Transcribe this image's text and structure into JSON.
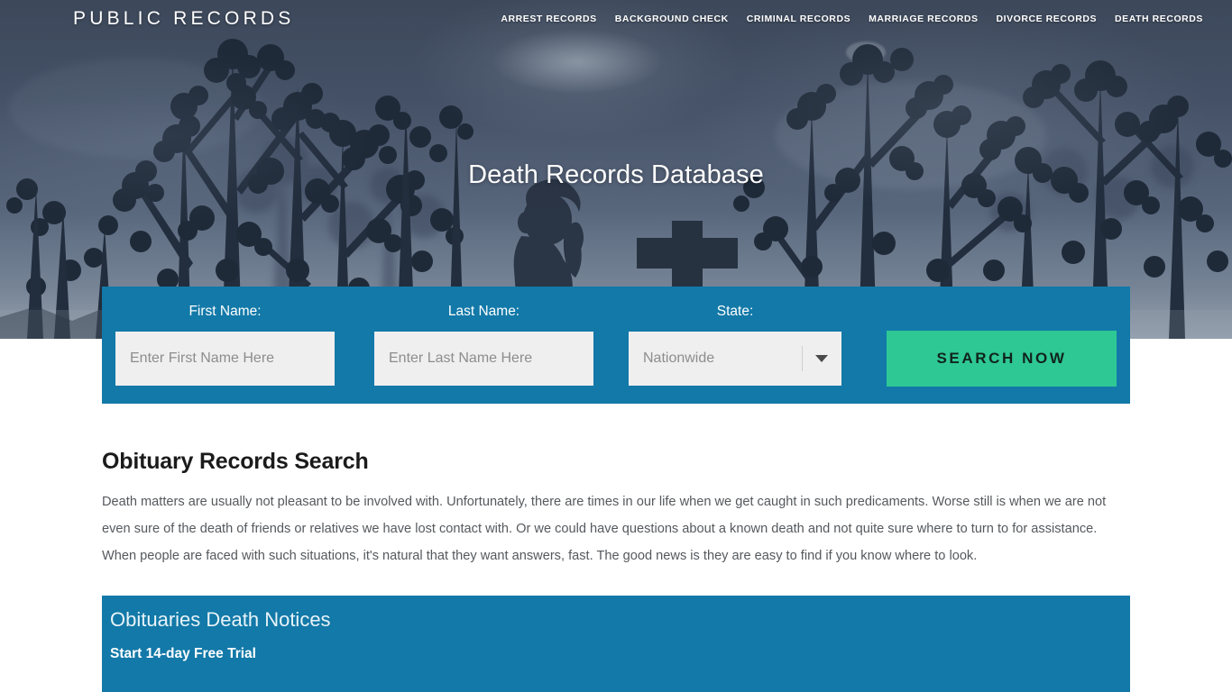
{
  "header": {
    "logo": "PUBLIC RECORDS",
    "nav": [
      {
        "label": "ARREST RECORDS"
      },
      {
        "label": "BACKGROUND CHECK"
      },
      {
        "label": "CRIMINAL RECORDS"
      },
      {
        "label": "MARRIAGE RECORDS"
      },
      {
        "label": "DIVORCE RECORDS"
      },
      {
        "label": "DEATH RECORDS"
      }
    ]
  },
  "hero": {
    "title": "Death Records Database",
    "art": {
      "description": "silhouette of praying girl and stone cross among blossoming branches at dusk",
      "sky_top_color": "#4c586b",
      "sky_bottom_color": "#8d99a8",
      "silhouette_color": "#232e3e"
    }
  },
  "search_form": {
    "background_color": "#1279a8",
    "first_name": {
      "label": "First Name:",
      "placeholder": "Enter First Name Here",
      "value": ""
    },
    "last_name": {
      "label": "Last Name:",
      "placeholder": "Enter Last Name Here",
      "value": ""
    },
    "state": {
      "label": "State:",
      "selected": "Nationwide",
      "options": [
        "Nationwide"
      ]
    },
    "submit": {
      "label": "SEARCH NOW",
      "color": "#2ec894"
    }
  },
  "main": {
    "section_title": "Obituary Records Search",
    "paragraph": "Death matters are usually not pleasant to be involved with. Unfortunately, there are times in our life when we get caught in such predicaments. Worse still is when we are not even sure of the death of friends or relatives we have lost contact with. Or we could have questions about a known death and not quite sure where to turn to for assistance. When people are faced with such situations, it's natural that they want answers, fast. The good news is they are easy to find if you know where to look."
  },
  "promo": {
    "title": "Obituaries Death Notices",
    "subtitle": "Start 14-day Free Trial",
    "background_color": "#1279a8"
  }
}
